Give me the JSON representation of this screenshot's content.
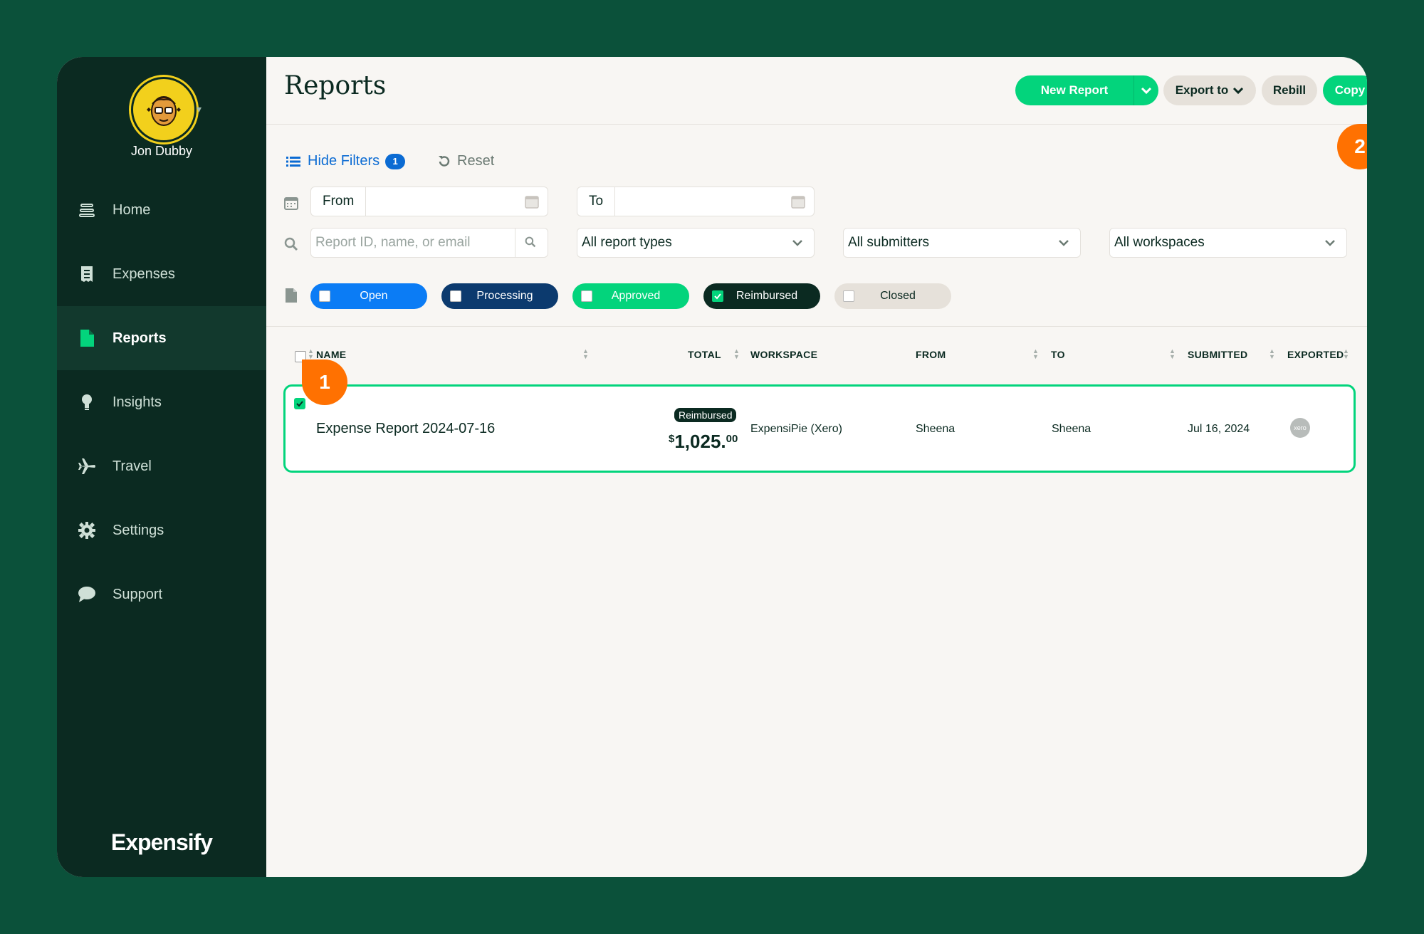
{
  "user": {
    "name": "Jon Dubby"
  },
  "nav": {
    "items": [
      {
        "label": "Home",
        "icon": "home-icon"
      },
      {
        "label": "Expenses",
        "icon": "receipt-icon"
      },
      {
        "label": "Reports",
        "icon": "document-icon"
      },
      {
        "label": "Insights",
        "icon": "lightbulb-icon"
      },
      {
        "label": "Travel",
        "icon": "plane-icon"
      },
      {
        "label": "Settings",
        "icon": "gear-icon"
      },
      {
        "label": "Support",
        "icon": "chat-icon"
      }
    ],
    "active": "Reports"
  },
  "brand": {
    "logo_text": "Expensify"
  },
  "header": {
    "title": "Reports",
    "new_report_label": "New Report",
    "export_label": "Export to",
    "rebill_label": "Rebill",
    "copy_label": "Copy"
  },
  "annotations": {
    "step1": "1",
    "step2": "2"
  },
  "filters": {
    "hide_label": "Hide Filters",
    "count": "1",
    "reset_label": "Reset",
    "from_label": "From",
    "to_label": "To",
    "search_placeholder": "Report ID, name, or email",
    "report_types": "All report types",
    "submitters": "All submitters",
    "workspaces": "All workspaces",
    "statuses": [
      {
        "label": "Open",
        "checked": false,
        "color": "#0b7cf5"
      },
      {
        "label": "Processing",
        "checked": false,
        "color": "#0c3a6e"
      },
      {
        "label": "Approved",
        "checked": false,
        "color": "#03d47c"
      },
      {
        "label": "Reimbursed",
        "checked": true,
        "color": "#0b2a21"
      },
      {
        "label": "Closed",
        "checked": false,
        "color": "#e6e1da"
      }
    ]
  },
  "table": {
    "headers": {
      "name": "NAME",
      "total": "TOTAL",
      "workspace": "WORKSPACE",
      "from": "FROM",
      "to": "TO",
      "submitted": "SUBMITTED",
      "exported": "EXPORTED"
    },
    "rows": [
      {
        "name": "Expense Report 2024-07-16",
        "status": "Reimbursed",
        "currency": "$",
        "amount_main": "1,025.",
        "amount_cents": "00",
        "workspace": "ExpensiPie (Xero)",
        "from": "Sheena",
        "to": "Sheena",
        "submitted": "Jul 16, 2024",
        "exported_icon": "xero",
        "selected": true
      }
    ]
  },
  "colors": {
    "accent": "#03d47c",
    "sidebar": "#0b2a21",
    "background": "#0b513a",
    "marker": "#ff7101",
    "link": "#0b6bd3"
  }
}
